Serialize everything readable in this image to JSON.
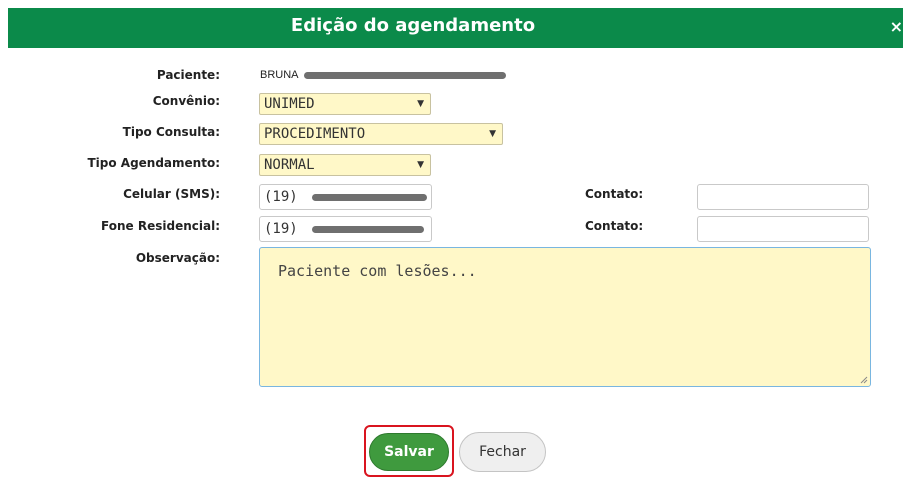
{
  "dialog": {
    "title": "Edição do agendamento",
    "close_symbol": "×",
    "close_icon": "close-icon"
  },
  "form": {
    "paciente": {
      "label": "Paciente:",
      "value": "BRUNA"
    },
    "convenio": {
      "label": "Convênio:",
      "value": "UNIMED"
    },
    "tipo_consulta": {
      "label": "Tipo Consulta:",
      "value": "PROCEDIMENTO"
    },
    "tipo_agendamento": {
      "label": "Tipo Agendamento:",
      "value": "NORMAL"
    },
    "celular": {
      "label": "Celular (SMS):",
      "value": "(19)"
    },
    "celular_contato": {
      "label": "Contato:",
      "value": ""
    },
    "fone_residencial": {
      "label": "Fone Residencial:",
      "value": "(19)"
    },
    "fone_contato": {
      "label": "Contato:",
      "value": ""
    },
    "observacao": {
      "label": "Observação:",
      "value": "Paciente com lesões..."
    }
  },
  "buttons": {
    "save_label": "Salvar",
    "close_label": "Fechar"
  },
  "colors": {
    "header_bg": "#0b8a4a",
    "field_bg": "#fff8c8",
    "save_bg": "#3f9a3e",
    "highlight": "#d9141f"
  }
}
